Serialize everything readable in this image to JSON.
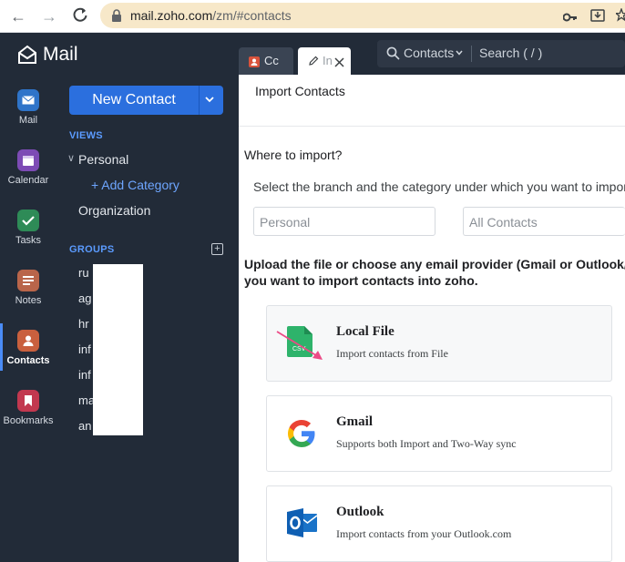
{
  "browser": {
    "url_host": "mail.zoho.com",
    "url_path": "/zm/#contacts"
  },
  "app": {
    "logo": "Mail",
    "rail": [
      {
        "label": "Mail",
        "icon": "mail-icon",
        "color": "#2f74c9"
      },
      {
        "label": "Calendar",
        "icon": "calendar-icon",
        "color": "#7d4bb5"
      },
      {
        "label": "Tasks",
        "icon": "tasks-icon",
        "color": "#2e8b57"
      },
      {
        "label": "Notes",
        "icon": "notes-icon",
        "color": "#b9654a"
      },
      {
        "label": "Contacts",
        "icon": "contacts-icon",
        "color": "#c9603e"
      },
      {
        "label": "Bookmarks",
        "icon": "bookmark-icon",
        "color": "#c2384f"
      }
    ]
  },
  "sidebar": {
    "new_contact": "New Contact",
    "views_title": "VIEWS",
    "personal": "Personal",
    "add_category": "+ Add Category",
    "organization": "Organization",
    "groups_title": "GROUPS",
    "groups": [
      "ru",
      "ag",
      "hr",
      "inf",
      "inf",
      "ma",
      "an"
    ]
  },
  "tabs": [
    {
      "label": "Cc"
    },
    {
      "label": "In"
    }
  ],
  "search": {
    "scope": "Contacts",
    "placeholder": "Search ( / )"
  },
  "import": {
    "title": "Import Contacts",
    "where": "Where to import?",
    "select_text": "Select the branch and the category under which you want to import",
    "field1": "Personal",
    "field2": "All Contacts",
    "upload_line1": "Upload the file or choose any email provider (Gmail or Outlook/Hot",
    "upload_line2": "you want to import contacts into zoho.",
    "options": [
      {
        "title": "Local File",
        "subtitle": "Import contacts from File",
        "icon": "csv-file-icon",
        "badge": "CSV"
      },
      {
        "title": "Gmail",
        "subtitle": "Supports both Import and Two-Way sync",
        "icon": "google-icon"
      },
      {
        "title": "Outlook",
        "subtitle": "Import contacts from your Outlook.com",
        "icon": "outlook-icon"
      }
    ]
  },
  "colors": {
    "accent": "#2b6fde",
    "sidebar_bg": "#222b38",
    "annotation_arrow": "#ec4a86"
  }
}
